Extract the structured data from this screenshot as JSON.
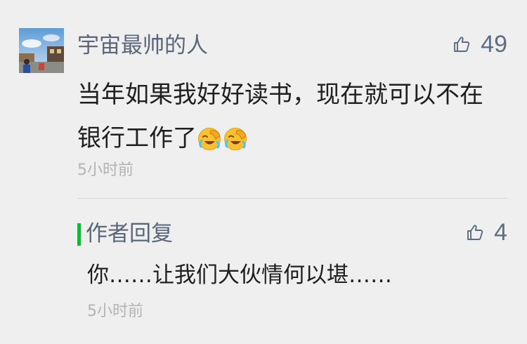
{
  "comment": {
    "username": "宇宙最帅的人",
    "likes": "49",
    "text": "当年如果我好好读书，现在就可以不在银行工作了",
    "emojis": [
      "facepalm-laughing-emoji",
      "facepalm-laughing-emoji"
    ],
    "timestamp": "5小时前"
  },
  "reply": {
    "label": "作者回复",
    "likes": "4",
    "text": "你……让我们大伙情何以堪……",
    "timestamp": "5小时前",
    "accent_color": "#18b33d"
  },
  "colors": {
    "background": "#efefef",
    "name": "#5b6679",
    "body_text": "#1f1f1f",
    "timestamp": "#b3b3b3",
    "like_icon": "#5c6b82"
  }
}
